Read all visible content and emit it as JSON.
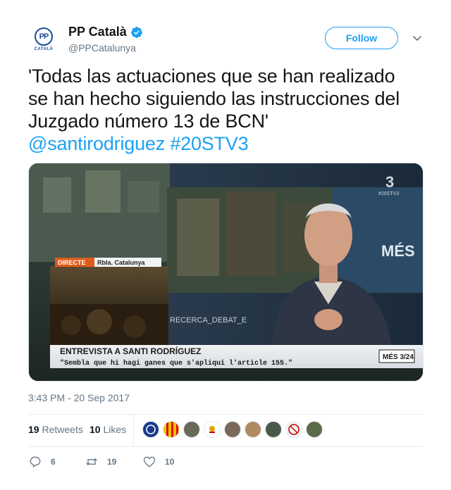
{
  "account": {
    "display_name": "PP Català",
    "handle": "@PPCatalunya",
    "verified": true,
    "avatar_logo_text": "PP",
    "avatar_logo_sub": "CATALÀ"
  },
  "follow_label": "Follow",
  "tweet": {
    "text_lines": [
      "'Todas las actuaciones que se han realizado",
      "se han hecho siguiendo las instrucciones del",
      "Juzgado número 13 de BCN'"
    ],
    "mention": "@santirodriguez",
    "hashtag": "#20STV3"
  },
  "media": {
    "live_badge": "DIRECTE",
    "location": "Rbla. Catalunya",
    "channel_tag": "#20STV3",
    "studio_text": "MÉS",
    "set_text": "RECERCA_DEBAT_E",
    "headline": "ENTREVISTA A SANTI RODRÍGUEZ",
    "quote": "\"Sembla que hi hagi ganes que s'apliqui l'article 155.\"",
    "program_logo": "MÉS 3/24"
  },
  "timestamp": "3:43 PM - 20 Sep 2017",
  "stats": {
    "retweets_count": "19",
    "retweets_label": "Retweets",
    "likes_count": "10",
    "likes_label": "Likes"
  },
  "actions": {
    "replies": "6",
    "retweets": "19",
    "likes": "10"
  },
  "colors": {
    "accent": "#1da1f2",
    "muted": "#657786",
    "text": "#14171a",
    "brand": "#1b4f9c"
  }
}
